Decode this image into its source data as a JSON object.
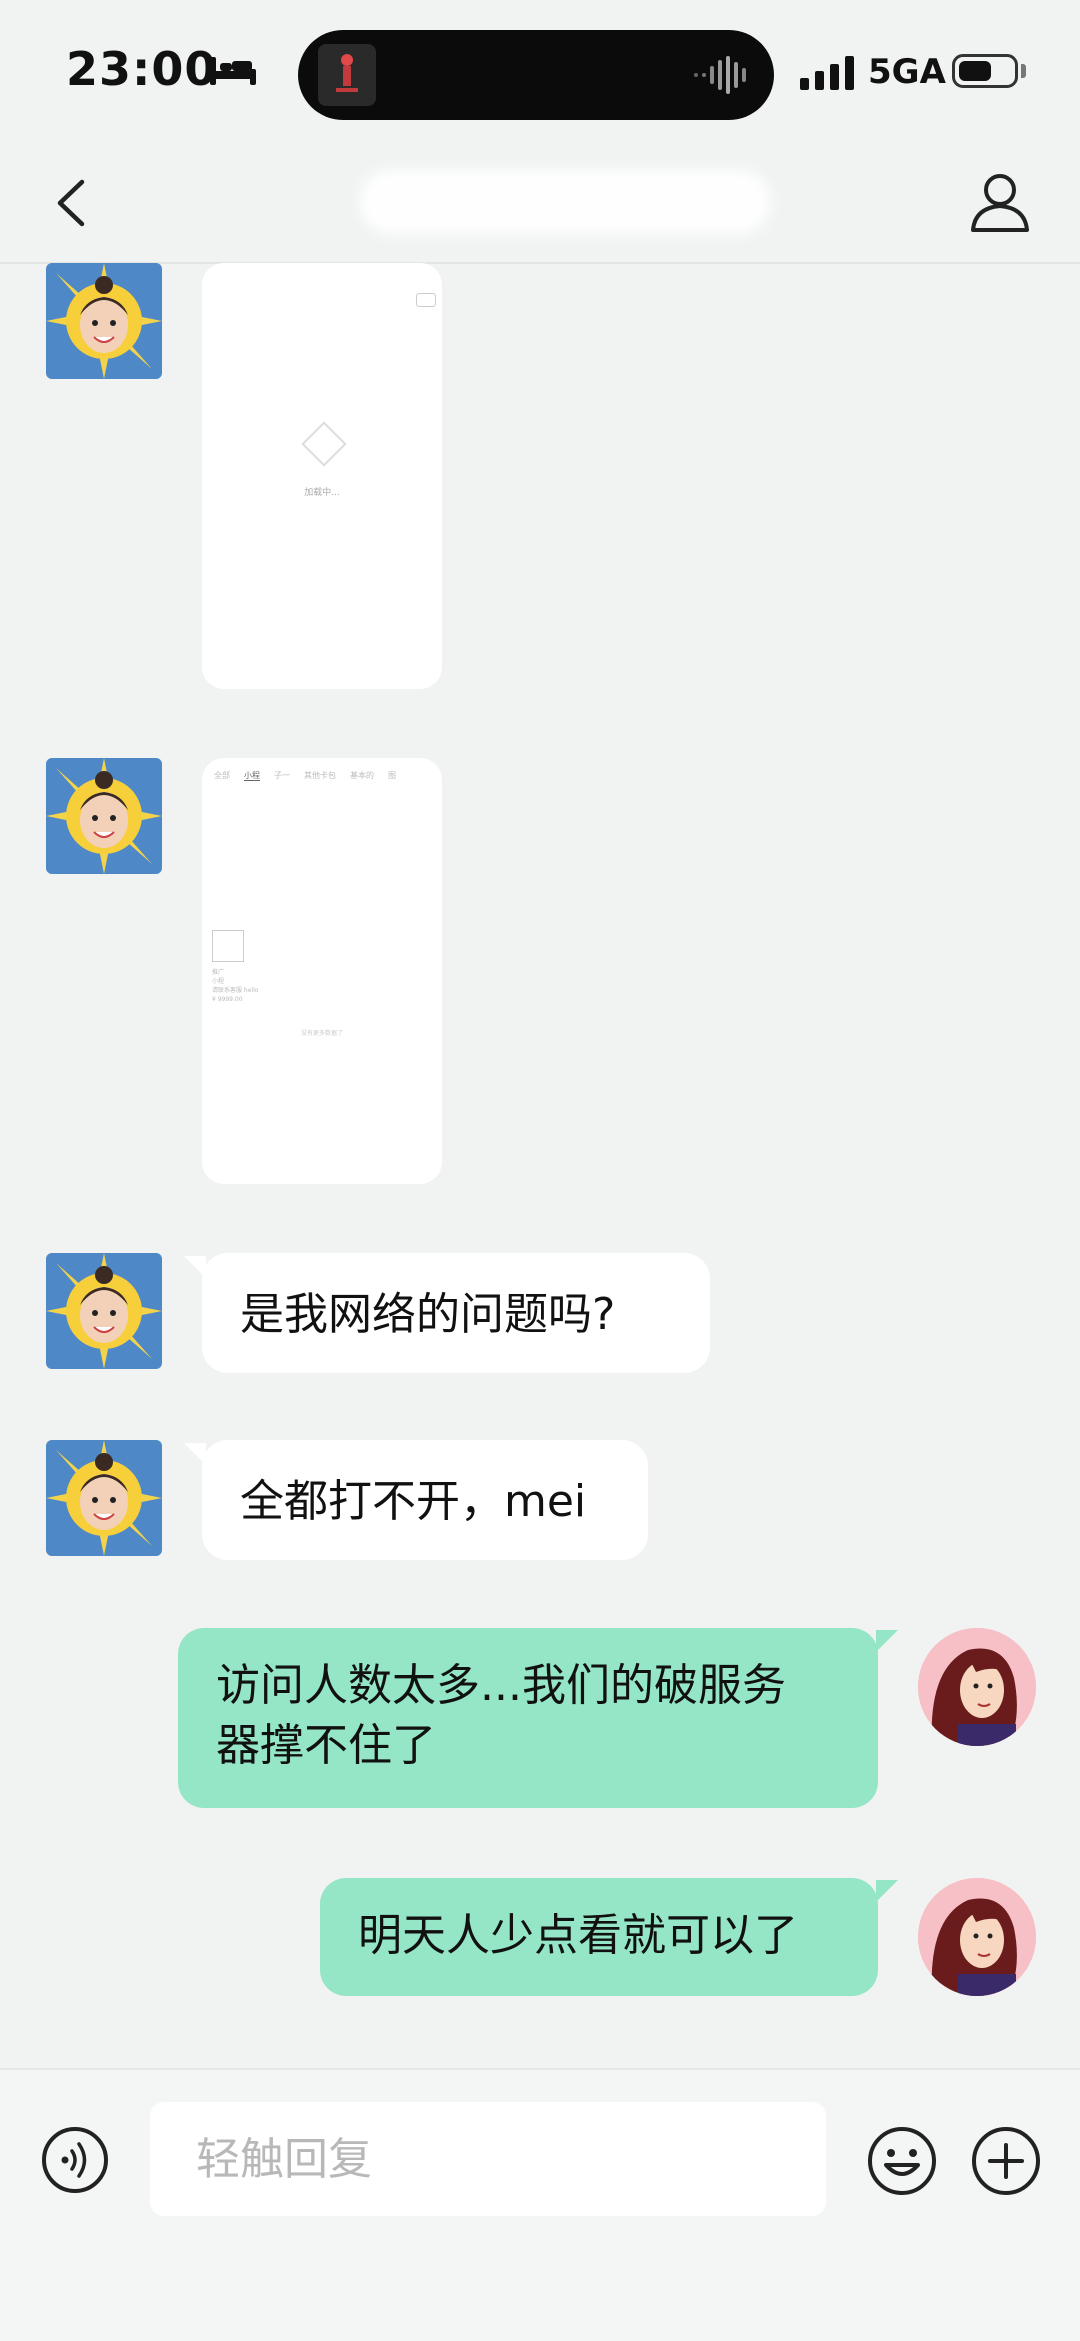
{
  "status_bar": {
    "time": "23:00",
    "network": "5GA",
    "battery_level": 0.6,
    "icons": [
      "bed-icon",
      "signal-icon",
      "battery-icon",
      "waveform-icon"
    ]
  },
  "nav": {
    "title": "",
    "back_icon": "chevron-left-icon",
    "profile_icon": "person-icon"
  },
  "image_messages": [
    {
      "loading_text": "加载中..."
    },
    {
      "tabs": [
        "全部",
        "小程",
        "子一",
        "其他卡包",
        "基本的",
        "图"
      ],
      "lines": [
        "推广",
        "小程",
        "请联系客服 hello",
        "¥ 9999.00"
      ],
      "footer": "没有更多数据了"
    }
  ],
  "messages": {
    "incoming_1": "是我网络的问题吗?",
    "incoming_2": "全都打不开，mei",
    "outgoing_1_line1": "访问人数太多...我们的破服务",
    "outgoing_1_line2": "器撑不住了",
    "outgoing_2": "明天人少点看就可以了"
  },
  "input_bar": {
    "placeholder": "轻触回复",
    "icons": [
      "voice-icon",
      "emoji-icon",
      "plus-icon"
    ]
  },
  "colors": {
    "background": "#f1f3f3",
    "outgoing_bubble": "#95e6c6",
    "incoming_bubble": "#ffffff"
  }
}
